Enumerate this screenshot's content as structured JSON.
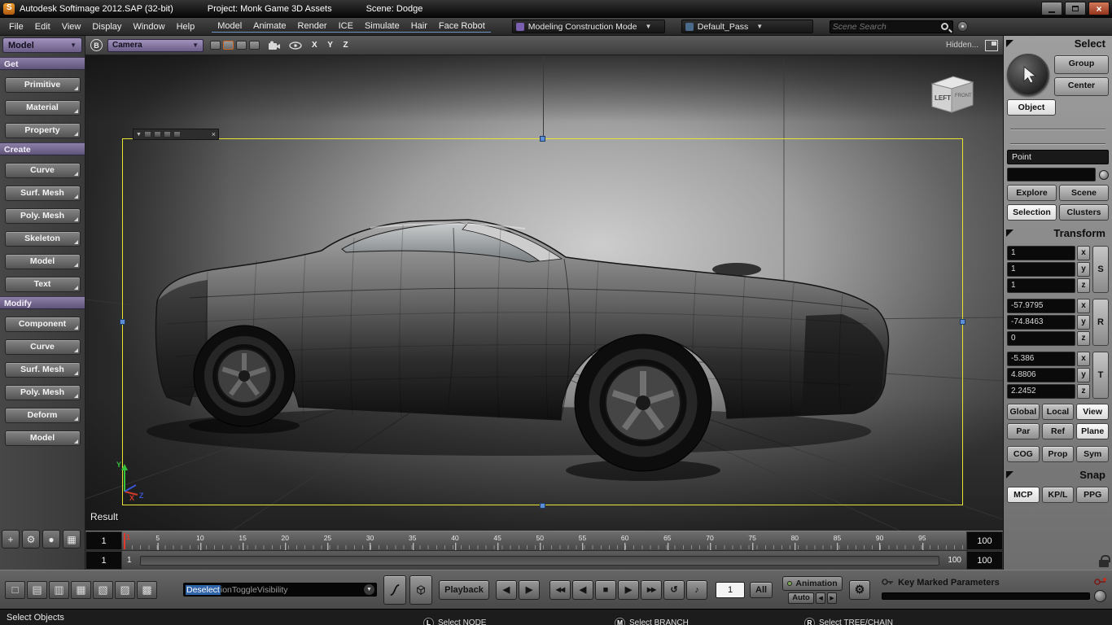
{
  "title_bar": {
    "app_title": "Autodesk Softimage 2012.SAP (32-bit)",
    "project_label": "Project: Monk Game 3D Assets",
    "scene_label": "Scene: Dodge"
  },
  "menu_bar": {
    "left_menus": [
      "File",
      "Edit",
      "View",
      "Display",
      "Window",
      "Help"
    ],
    "main_menus": [
      "Model",
      "Animate",
      "Render",
      "ICE",
      "Simulate",
      "Hair",
      "Face Robot"
    ],
    "construction_mode_label": "Modeling Construction Mode",
    "render_pass_label": "Default_Pass",
    "search_placeholder": "Scene Search"
  },
  "left_panel": {
    "model_selector_label": "Model",
    "sections": [
      {
        "header": "Get",
        "buttons": [
          "Primitive",
          "Material",
          "Property"
        ]
      },
      {
        "header": "Create",
        "buttons": [
          "Curve",
          "Surf. Mesh",
          "Poly. Mesh",
          "Skeleton",
          "Model",
          "Text"
        ]
      },
      {
        "header": "Modify",
        "buttons": [
          "Component",
          "Curve",
          "Surf. Mesh",
          "Poly. Mesh",
          "Deform",
          "Model"
        ]
      }
    ],
    "bottom_tools": [
      "transform-tool",
      "tools",
      "render-region",
      "pane-layout"
    ]
  },
  "viewport": {
    "header": {
      "b_badge": "B",
      "camera_label": "Camera",
      "axis_labels": "X Y Z",
      "hidden_label": "Hidden..."
    },
    "result_label": "Result",
    "cube": {
      "front_face": "LEFT",
      "side_face": "FRONT"
    },
    "axis": {
      "x": "X",
      "y": "Y",
      "z": "Z"
    },
    "frame_color": "#e8e335"
  },
  "right_panel": {
    "select_header": "Select",
    "group_label": "Group",
    "center_label": "Center",
    "object_label": "Object",
    "point_filter_label": "Point",
    "explore_label": "Explore",
    "scene_label": "Scene",
    "selection_label": "Selection",
    "clusters_label": "Clusters",
    "transform": {
      "header": "Transform",
      "groups": [
        {
          "key": "S",
          "rows": [
            {
              "axis": "x",
              "value": "1"
            },
            {
              "axis": "y",
              "value": "1"
            },
            {
              "axis": "z",
              "value": "1"
            }
          ]
        },
        {
          "key": "R",
          "rows": [
            {
              "axis": "x",
              "value": "-57.9795"
            },
            {
              "axis": "y",
              "value": "-74.8463"
            },
            {
              "axis": "z",
              "value": "0"
            }
          ]
        },
        {
          "key": "T",
          "rows": [
            {
              "axis": "x",
              "value": "-5.386"
            },
            {
              "axis": "y",
              "value": "4.8806"
            },
            {
              "axis": "z",
              "value": "2.2452"
            }
          ]
        }
      ],
      "space_buttons": [
        "Global",
        "Local",
        "View"
      ],
      "active_space": "View",
      "ref_buttons": [
        "Par",
        "Ref",
        "Plane"
      ],
      "active_ref": "Plane",
      "extra_buttons": [
        "COG",
        "Prop",
        "Sym"
      ]
    },
    "snap": {
      "header": "Snap",
      "buttons": [
        "MCP",
        "KP/L",
        "PPG"
      ],
      "active": "MCP"
    }
  },
  "timeline": {
    "start_box": "1",
    "end_box": "100",
    "current_frame": "1",
    "ticks": [
      5,
      10,
      15,
      20,
      25,
      30,
      35,
      40,
      45,
      50,
      55,
      60,
      65,
      70,
      75,
      80,
      85,
      90,
      95
    ],
    "range": {
      "left_box": "1",
      "left_label": "1",
      "right_label": "100",
      "right_box": "100"
    }
  },
  "playback": {
    "layout_icons": [
      "layout-single",
      "layout-rows",
      "layout-cols",
      "layout-grid",
      "layout-left",
      "layout-right",
      "layout-mixed"
    ],
    "script_selected": "Deselect",
    "script_rest": "ionToggleVisibility",
    "playback_label": "Playback",
    "step_buttons": [
      "step-back",
      "step-forward"
    ],
    "transport": [
      "first-frame",
      "prev-frame",
      "stop",
      "play",
      "last-frame"
    ],
    "loop_button": "loop",
    "audio_button": "audio",
    "frame_field": "1",
    "all_label": "All",
    "animation_label": "Animation",
    "auto_label": "Auto",
    "key_marked_label": "Key Marked Parameters"
  },
  "status_bar": {
    "left_text": "Select Objects",
    "hints": [
      {
        "badge": "L",
        "text": "Select NODE"
      },
      {
        "badge": "M",
        "text": "Select BRANCH"
      },
      {
        "badge": "R",
        "text": "Select TREE/CHAIN"
      }
    ]
  }
}
